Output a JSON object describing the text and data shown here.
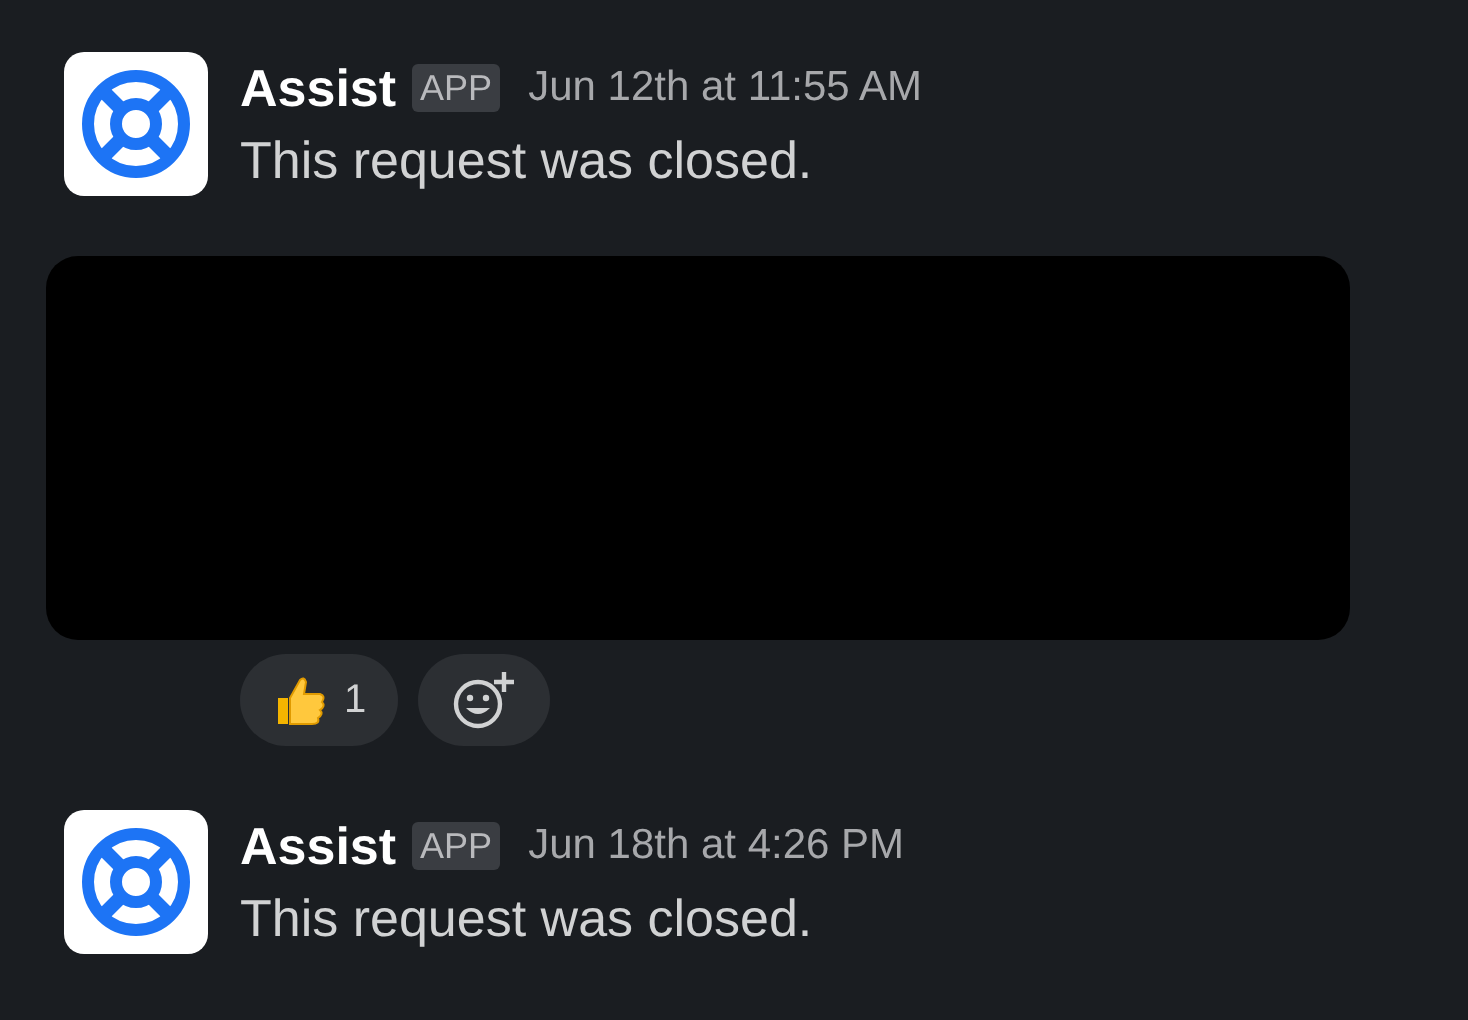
{
  "messages": [
    {
      "sender": "Assist",
      "badge": "APP",
      "time": "Jun 12th at 11:55 AM",
      "text": "This request was closed.",
      "redacted": true,
      "reactions": [
        {
          "count": "1"
        }
      ]
    },
    {
      "sender": "Assist",
      "badge": "APP",
      "time": "Jun 18th at 4:26 PM",
      "text": "This request was closed."
    }
  ]
}
